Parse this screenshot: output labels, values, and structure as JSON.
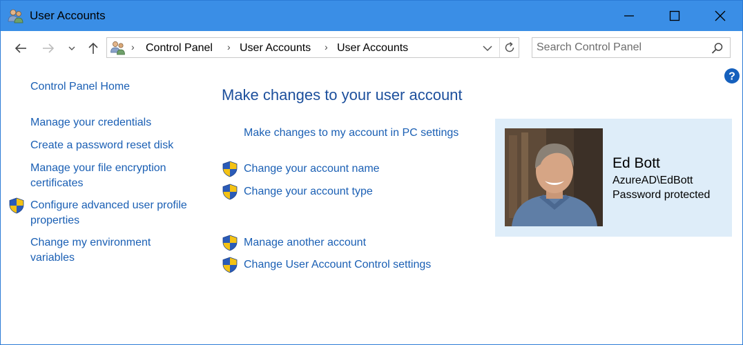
{
  "window": {
    "title": "User Accounts",
    "titlebar_color": "#3a8ee6"
  },
  "address": {
    "breadcrumbs": [
      "Control Panel",
      "User Accounts",
      "User Accounts"
    ],
    "search_placeholder": "Search Control Panel"
  },
  "sidebar": {
    "items": [
      {
        "label": "Control Panel Home",
        "shield": false
      },
      {
        "label": "Manage your credentials",
        "shield": false
      },
      {
        "label": "Create a password reset disk",
        "shield": false
      },
      {
        "label": "Manage your file encryption certificates",
        "shield": false
      },
      {
        "label": "Configure advanced user profile properties",
        "shield": true
      },
      {
        "label": "Change my environment variables",
        "shield": false
      }
    ]
  },
  "main": {
    "title": "Make changes to your user account",
    "links": [
      {
        "label": "Make changes to my account in PC settings",
        "shield": false
      },
      {
        "label": "Change your account name",
        "shield": true
      },
      {
        "label": "Change your account type",
        "shield": true
      },
      {
        "label": "Manage another account",
        "shield": true
      },
      {
        "label": "Change User Account Control settings",
        "shield": true
      }
    ]
  },
  "user": {
    "name": "Ed Bott",
    "account": "AzureAD\\EdBott",
    "status": "Password protected"
  },
  "colors": {
    "link": "#1a5fb4",
    "heading": "#1c4f9c",
    "card_background": "#deedf9"
  },
  "icons": [
    "users-icon",
    "minimize-icon",
    "maximize-icon",
    "close-icon",
    "back-arrow-icon",
    "forward-arrow-icon",
    "chevron-down-icon",
    "up-arrow-icon",
    "refresh-icon",
    "search-icon",
    "help-icon",
    "uac-shield-icon"
  ]
}
